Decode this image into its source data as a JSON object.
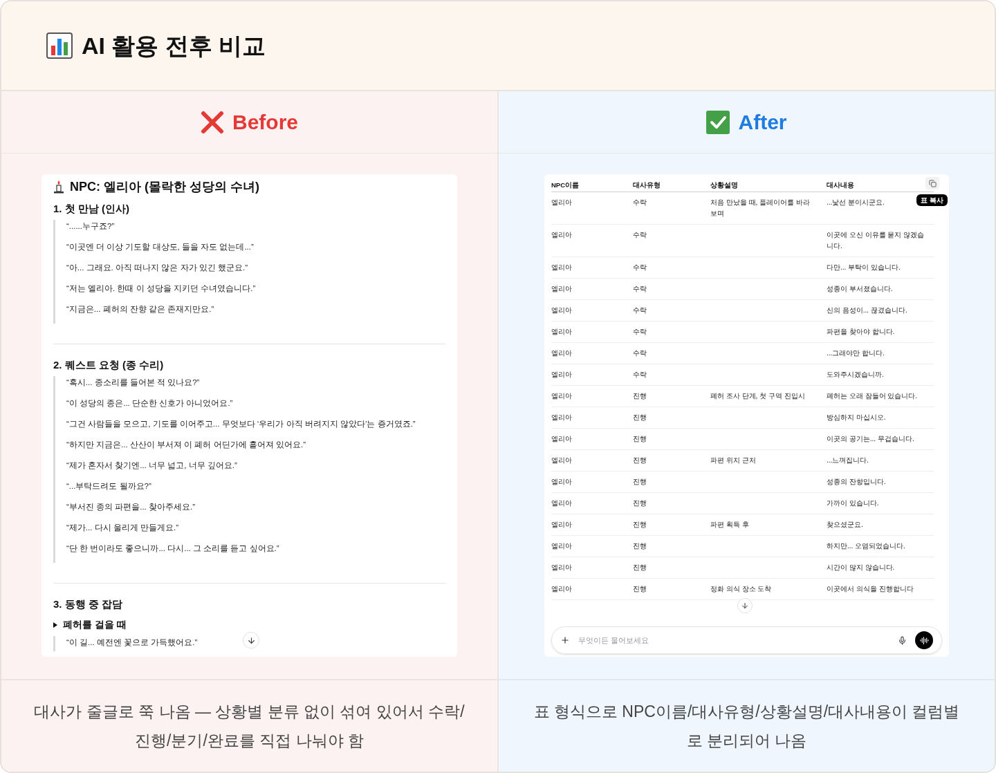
{
  "title": "AI 활용 전후 비교",
  "before": {
    "heading": "Before",
    "doc": {
      "title": "NPC: 엘리아 (몰락한 성당의 수녀)",
      "sections": [
        {
          "heading": "1. 첫 만남 (인사)",
          "quotes": [
            "“......누구죠?”",
            "“이곳엔 더 이상 기도할 대상도, 들을 자도 없는데...”",
            "“아... 그래요. 아직 떠나지 않은 자가 있긴 했군요.”",
            "“저는 엘리아. 한때 이 성당을 지키던 수녀였습니다.”",
            "“지금은... 폐허의 잔향 같은 존재지만요.”"
          ]
        },
        {
          "heading": "2. 퀘스트 요청 (종 수리)",
          "quotes": [
            "“혹시... 종소리를 들어본 적 있나요?”",
            "“이 성당의 종은... 단순한 신호가 아니었어요.”",
            "“그건 사람들을 모으고, 기도를 이어주고... 무엇보다 ‘우리가 아직 버려지지 않았다’는 증거였죠.”",
            "“하지만 지금은... 산산이 부서져 이 폐허 어딘가에 흩어져 있어요.”",
            "“제가 혼자서 찾기엔... 너무 넓고, 너무 깊어요.”",
            "“...부탁드려도 될까요?”",
            "“부서진 종의 파편을... 찾아주세요.”",
            "“제가... 다시 울리게 만들게요.”",
            "“단 한 번이라도 좋으니까... 다시... 그 소리를 듣고 싶어요.”"
          ]
        },
        {
          "heading": "3. 동행 중 잡담",
          "toggle": {
            "label": "폐허를 걸을 때",
            "quotes": [
              "“이 길... 예전엔 꽃으로 가득했어요.”"
            ]
          }
        }
      ]
    },
    "caption": "대사가 줄글로 쭉 나옴 — 상황별 분류 없이 섞여 있어서 수락/진행/분기/완료를 직접 나눠야 함"
  },
  "after": {
    "heading": "After",
    "table": {
      "columns": [
        "NPC이름",
        "대사유형",
        "상황설명",
        "대사내용"
      ],
      "copy_tooltip": "표 복사",
      "rows": [
        {
          "npc": "엘리아",
          "type": "수락",
          "situation": "처음 만났을 때, 플레이어를 바라보며",
          "line": "...낯선 분이시군요."
        },
        {
          "npc": "엘리아",
          "type": "수락",
          "line": "이곳에 오신 이유를 묻지 않겠습니다."
        },
        {
          "npc": "엘리아",
          "type": "수락",
          "line": "다만... 부탁이 있습니다."
        },
        {
          "npc": "엘리아",
          "type": "수락",
          "line": "성종이 부서졌습니다."
        },
        {
          "npc": "엘리아",
          "type": "수락",
          "line": "신의 음성이... 끊겼습니다."
        },
        {
          "npc": "엘리아",
          "type": "수락",
          "line": "파편을 찾아야 합니다."
        },
        {
          "npc": "엘리아",
          "type": "수락",
          "line": "...그래야만 합니다."
        },
        {
          "npc": "엘리아",
          "type": "수락",
          "line": "도와주시겠습니까."
        },
        {
          "npc": "엘리아",
          "type": "진행",
          "situation": "폐허 조사 단계, 첫 구역 진입시",
          "line": "폐허는 오래 잠들어 있습니다."
        },
        {
          "npc": "엘리아",
          "type": "진행",
          "line": "방심하지 마십시오."
        },
        {
          "npc": "엘리아",
          "type": "진행",
          "line": "이곳의 공기는... 무겁습니다."
        },
        {
          "npc": "엘리아",
          "type": "진행",
          "situation": "파편 위치 근처",
          "line": "...느껴집니다."
        },
        {
          "npc": "엘리아",
          "type": "진행",
          "line": "성종의 잔향입니다."
        },
        {
          "npc": "엘리아",
          "type": "진행",
          "line": "가까이 있습니다."
        },
        {
          "npc": "엘리아",
          "type": "진행",
          "situation": "파편 획득 후",
          "line": "찾으셨군요."
        },
        {
          "npc": "엘리아",
          "type": "진행",
          "line": "하지만... 오염되었습니다."
        },
        {
          "npc": "엘리아",
          "type": "진행",
          "line": "시간이 많지 않습니다."
        },
        {
          "npc": "엘리아",
          "type": "진행",
          "situation": "정화 의식 장소 도착",
          "line": "이곳에서 의식을 진행합니다"
        }
      ]
    },
    "composer": {
      "placeholder": "무엇이든 물어보세요"
    },
    "caption": "표 형식으로 NPC이름/대사유형/상황설명/대사내용이 컬럼별로 분리되어 나옴"
  }
}
